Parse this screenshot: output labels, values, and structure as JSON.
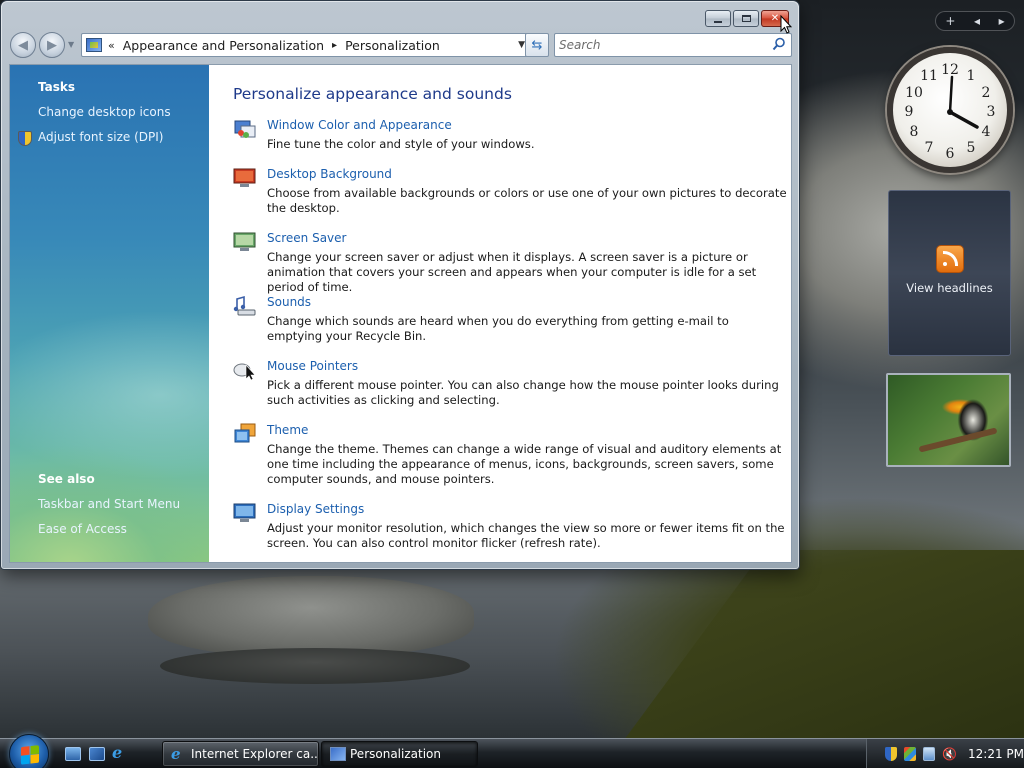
{
  "window": {
    "caption_buttons": {
      "minimize": "minimize",
      "maximize": "maximize",
      "close": "close"
    },
    "breadcrumb": {
      "lead": "«",
      "items": [
        "Appearance and Personalization",
        "Personalization"
      ],
      "separator": "▸"
    },
    "search_placeholder": "Search"
  },
  "tasks": {
    "heading": "Tasks",
    "links": [
      "Change desktop icons",
      "Adjust font size (DPI)"
    ],
    "see_also_heading": "See also",
    "see_also_links": [
      "Taskbar and Start Menu",
      "Ease of Access"
    ]
  },
  "main": {
    "title": "Personalize appearance and sounds",
    "items": [
      {
        "name": "Window Color and Appearance",
        "desc": "Fine tune the color and style of your windows.",
        "icon": "window-color-icon"
      },
      {
        "name": "Desktop Background",
        "desc": "Choose from available backgrounds or colors or use one of your own pictures to decorate the desktop.",
        "icon": "desktop-background-icon"
      },
      {
        "name": "Screen Saver",
        "desc": "Change your screen saver or adjust when it displays. A screen saver is a picture or animation that covers your screen and appears when your computer is idle for a set period of time.",
        "icon": "screen-saver-icon"
      },
      {
        "name": "Sounds",
        "desc": "Change which sounds are heard when you do everything from getting e-mail to emptying your Recycle Bin.",
        "icon": "sounds-icon"
      },
      {
        "name": "Mouse Pointers",
        "desc": "Pick a different mouse pointer. You can also change how the mouse pointer looks during such activities as clicking and selecting.",
        "icon": "mouse-pointers-icon"
      },
      {
        "name": "Theme",
        "desc": "Change the theme. Themes can change a wide range of visual and auditory elements at one time including the appearance of menus, icons, backgrounds, screen savers, some computer sounds, and mouse pointers.",
        "icon": "theme-icon"
      },
      {
        "name": "Display Settings",
        "desc": "Adjust your monitor resolution, which changes the view so more or fewer items fit on the screen. You can also control monitor flicker (refresh rate).",
        "icon": "display-settings-icon"
      }
    ]
  },
  "gadgets": {
    "bar": {
      "add": "+",
      "prev": "◂",
      "next": "▸"
    },
    "clock_numbers": [
      "12",
      "1",
      "2",
      "3",
      "4",
      "5",
      "6",
      "7",
      "8",
      "9",
      "10",
      "11"
    ],
    "feed_label": "View headlines"
  },
  "taskbar": {
    "tasks": [
      "Internet Explorer ca...",
      "Personalization"
    ],
    "clock": "12:21 PM"
  },
  "colors": {
    "link": "#1c5fae",
    "title": "#1e3a8a",
    "task_pane_top": "#2a73b3",
    "task_pane_bottom": "#8dc97f"
  }
}
